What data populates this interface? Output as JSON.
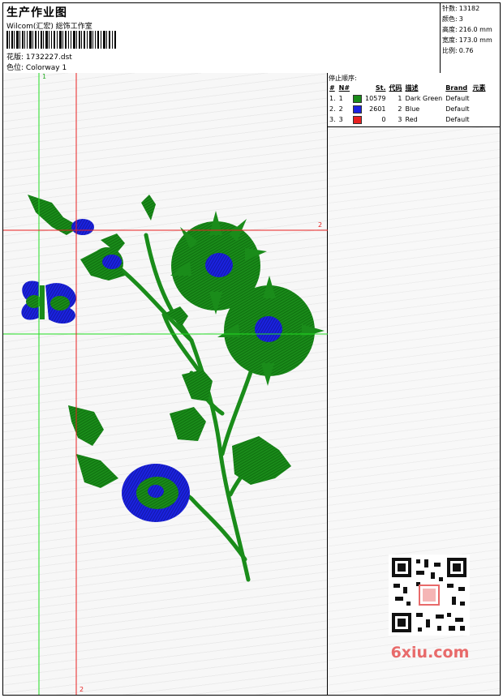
{
  "header": {
    "title": "生产作业图",
    "studio": "Wilcom(汇宏) 総饰工作室",
    "design_label": "花版:",
    "design_value": "1732227.dst",
    "colorway_label": "色位:",
    "colorway_value": "Colorway 1"
  },
  "stats": [
    {
      "label": "针数:",
      "value": "13182"
    },
    {
      "label": "颜色:",
      "value": "3"
    },
    {
      "label": "高度:",
      "value": "216.0 mm"
    },
    {
      "label": "宽度:",
      "value": "173.0 mm"
    },
    {
      "label": "比例:",
      "value": "0.76"
    }
  ],
  "stop_sequence": {
    "title": "停止顺序:",
    "columns": [
      "#",
      "N#",
      "St.",
      "代码",
      "描述",
      "Brand",
      "元素"
    ],
    "rows": [
      {
        "idx": "1.",
        "n": "1",
        "color": "#1a8c1a",
        "stitches": "10579",
        "code": "1",
        "desc": "Dark Green",
        "brand": "Default"
      },
      {
        "idx": "2.",
        "n": "2",
        "color": "#1b22e0",
        "stitches": "2601",
        "code": "2",
        "desc": "Blue",
        "brand": "Default"
      },
      {
        "idx": "3.",
        "n": "3",
        "color": "#e82020",
        "stitches": "0",
        "code": "3",
        "desc": "Red",
        "brand": "Default"
      }
    ]
  },
  "guides": {
    "green_v_label": "1",
    "red_h_label": "2",
    "red_v_label": "2"
  },
  "watermark": "6xiu.com",
  "colors": {
    "green": "#1a8c1a",
    "blue": "#1b22e0",
    "red_guide": "#e82020",
    "green_guide": "#22dd22"
  }
}
